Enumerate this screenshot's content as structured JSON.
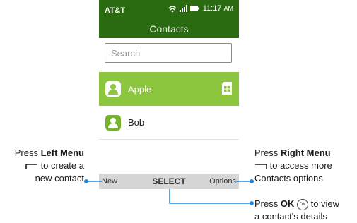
{
  "status_bar": {
    "carrier": "AT&T",
    "time": "11:17",
    "ampm": "AM"
  },
  "header": {
    "title": "Contacts"
  },
  "search": {
    "placeholder": "Search"
  },
  "contacts": [
    {
      "name": "Apple",
      "selected": true
    },
    {
      "name": "Bob",
      "selected": false
    }
  ],
  "softkeys": {
    "left": "New",
    "center": "SELECT",
    "right": "Options"
  },
  "callouts": {
    "left": {
      "prefix": "Press ",
      "key": "Left Menu",
      "line2": "to create a",
      "line3": "new contact"
    },
    "right": {
      "prefix": "Press ",
      "key": "Right Menu",
      "line2": "to access more",
      "line3": "Contacts options"
    },
    "ok": {
      "prefix": "Press ",
      "key": "OK",
      "line1_suffix": "to view",
      "line2": "a contact's details",
      "icon_text": "OK"
    }
  },
  "colors": {
    "status_green": "#2a6b12",
    "selected_row": "#8cc63e",
    "avatar_green": "#75b22e",
    "callout_blue": "#1e88e5"
  }
}
